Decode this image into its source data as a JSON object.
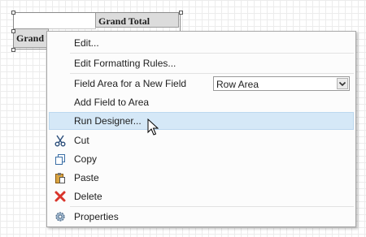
{
  "pivot": {
    "column_header": "Grand Total",
    "row_header": "Grand Total"
  },
  "menu": {
    "edit": "Edit...",
    "edit_formatting_rules": "Edit Formatting Rules...",
    "field_area_label": "Field Area for a New Field",
    "field_area_value": "Row Area",
    "add_field": "Add Field to Area",
    "run_designer": "Run Designer...",
    "cut": "Cut",
    "copy": "Copy",
    "paste": "Paste",
    "delete": "Delete",
    "properties": "Properties"
  },
  "colors": {
    "highlight": "#d5e8f7",
    "delete_icon": "#d9342b"
  },
  "icons": [
    "scissors-icon",
    "copy-icon",
    "clipboard-icon",
    "delete-x-icon",
    "gear-icon",
    "mouse-cursor-icon"
  ]
}
